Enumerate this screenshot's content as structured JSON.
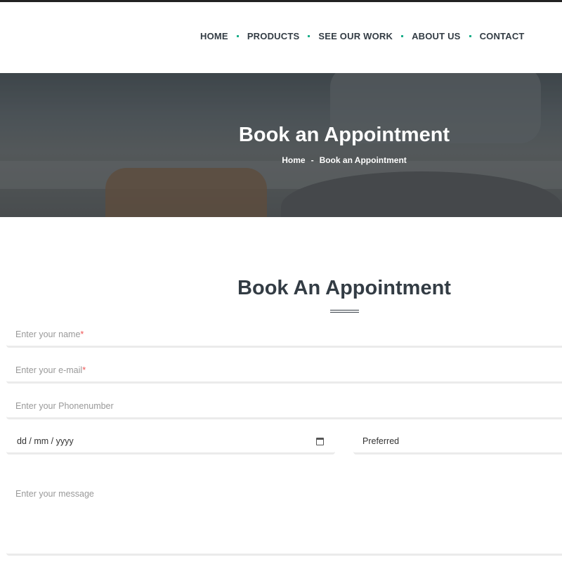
{
  "nav": {
    "items": [
      "HOME",
      "PRODUCTS",
      "SEE OUR WORK",
      "ABOUT US",
      "CONTACT"
    ]
  },
  "hero": {
    "title": "Book an Appointment",
    "breadcrumb": [
      "Home",
      "-",
      "Book an Appointment"
    ]
  },
  "form": {
    "title": "Book An Appointment",
    "name_placeholder": "Enter your name",
    "email_placeholder": "Enter your e-mail",
    "required_mark": "*",
    "phone_placeholder": "Enter your Phonenumber",
    "date_value": "dd / mm / yyyy",
    "preferred_value": "Preferred",
    "message_placeholder": "Enter your message"
  },
  "colors": {
    "accent": "#1aae8a",
    "text": "#333c44"
  }
}
